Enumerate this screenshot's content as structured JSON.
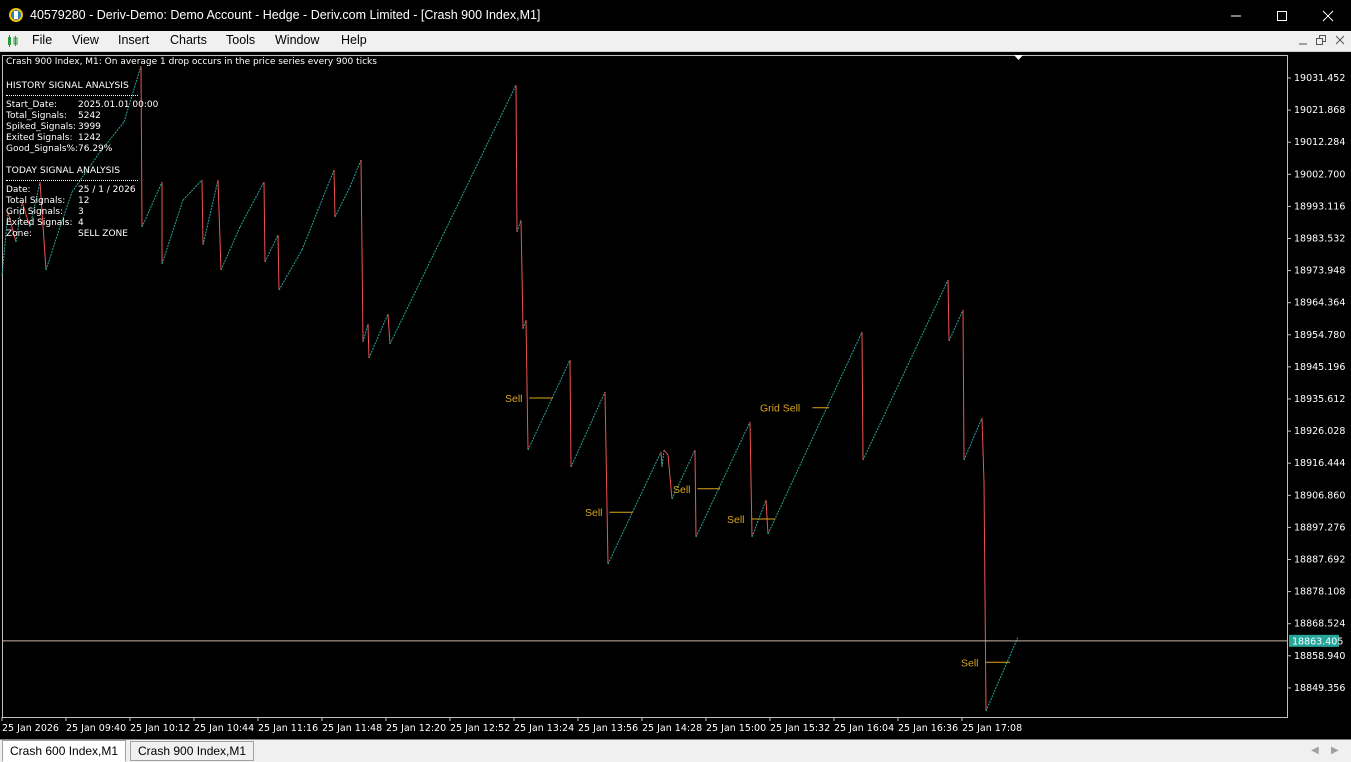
{
  "window": {
    "title": "40579280 - Deriv-Demo: Demo Account - Hedge - Deriv.com Limited - [Crash 900 Index,M1]",
    "minimize_icon": "minimize-icon",
    "maximize_icon": "maximize-icon",
    "close_icon": "close-icon"
  },
  "menu": {
    "items": [
      "File",
      "View",
      "Insert",
      "Charts",
      "Tools",
      "Window",
      "Help"
    ]
  },
  "chart": {
    "header": "Crash 900 Index, M1:  On average 1 drop occurs in the price series every 900 ticks",
    "history": {
      "title": "HISTORY SIGNAL ANALYSIS",
      "rows": [
        {
          "k": "Start_Date:",
          "v": "2025.01.01 00:00"
        },
        {
          "k": "Total_Signals:",
          "v": "5242"
        },
        {
          "k": "Spiked_Signals:",
          "v": "3999"
        },
        {
          "k": "Exited Signals:",
          "v": "1242"
        },
        {
          "k": "Good_Signals%:",
          "v": "76.29%"
        }
      ]
    },
    "today": {
      "title": "TODAY SIGNAL ANALYSIS",
      "rows": [
        {
          "k": "Date:",
          "v": "25 / 1 / 2026"
        },
        {
          "k": "Total Signals:",
          "v": "12"
        },
        {
          "k": "Grid Signals:",
          "v": "3"
        },
        {
          "k": "Exited Signals:",
          "v": "4"
        },
        {
          "k": "Zone:",
          "v": "SELL ZONE"
        }
      ]
    },
    "price_ticks": [
      "19031.452",
      "19021.868",
      "19012.284",
      "19002.700",
      "18993.116",
      "18983.532",
      "18973.948",
      "18964.364",
      "18954.780",
      "18945.196",
      "18935.612",
      "18926.028",
      "18916.444",
      "18906.860",
      "18897.276",
      "18887.692",
      "18878.108",
      "18868.524",
      "18858.940",
      "18849.356"
    ],
    "current_price": "18863.405",
    "time_ticks": [
      "25 Jan 2026",
      "25 Jan 09:40",
      "25 Jan 10:12",
      "25 Jan 10:44",
      "25 Jan 11:16",
      "25 Jan 11:48",
      "25 Jan 12:20",
      "25 Jan 12:52",
      "25 Jan 13:24",
      "25 Jan 13:56",
      "25 Jan 14:28",
      "25 Jan 15:00",
      "25 Jan 15:32",
      "25 Jan 16:04",
      "25 Jan 16:36",
      "25 Jan 17:08"
    ],
    "signals": [
      {
        "label": "Sell",
        "price": 18935.9
      },
      {
        "label": "Sell",
        "price": 18901.8
      },
      {
        "label": "Grid Sell",
        "price": 18933.0
      },
      {
        "label": "Sell",
        "price": 18908.8
      },
      {
        "label": "Sell",
        "price": 18899.8
      },
      {
        "label": "Sell",
        "price": 18857.0
      }
    ],
    "colors": {
      "up": "#26a69a",
      "down": "#ef5350",
      "signal": "#daa520",
      "price_line": "#c8b4a8",
      "price_label_bg": "#26a69a"
    }
  },
  "tabs": [
    "Crash 600 Index,M1",
    "Crash 900 Index,M1"
  ],
  "tabs_active": 0
}
